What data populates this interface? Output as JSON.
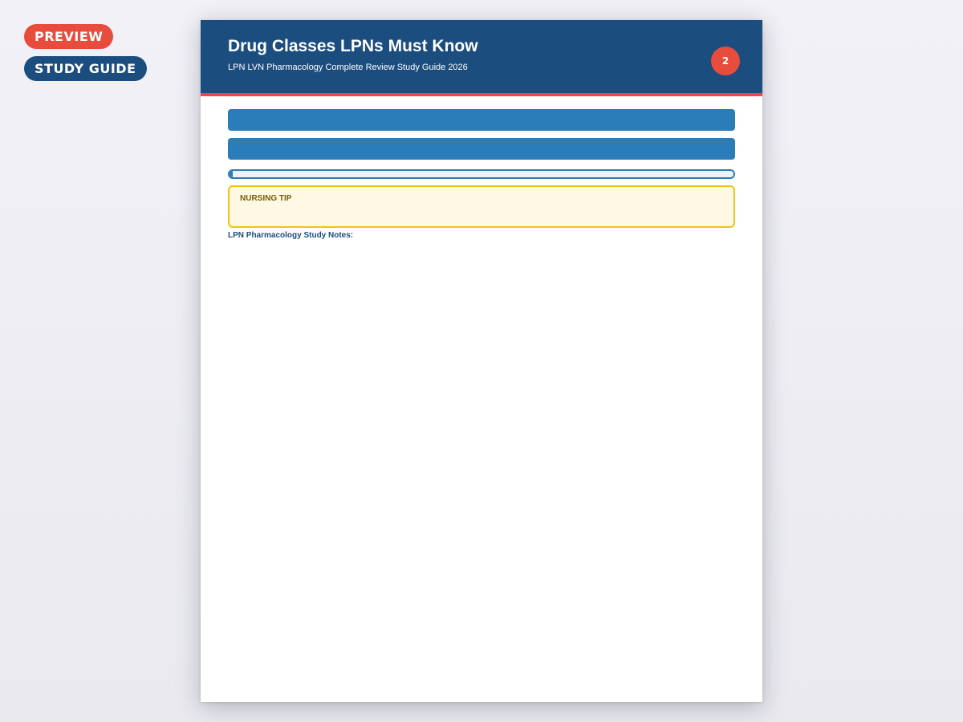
{
  "badges": {
    "preview": "PREVIEW",
    "study_guide": "STUDY GUIDE"
  },
  "page": {
    "title": "Drug Classes LPNs Must Know",
    "subtitle": "LPN LVN Pharmacology Complete Review Study Guide 2026",
    "page_number": "2"
  },
  "progress": {
    "fraction": 0.005
  },
  "nursing_tip": {
    "label": "NURSING TIP"
  },
  "notes": {
    "heading": "LPN Pharmacology Study Notes:"
  },
  "colors": {
    "preview_badge": "#e74c3c",
    "study_guide_badge": "#1b4d7e",
    "header_bg": "#1b4d7e",
    "header_accent": "#e74c3c",
    "page_number_bg": "#e74c3c",
    "section_bar": "#2a7db9",
    "progress_fill": "#2a7db9",
    "tip_border": "#f1c40f",
    "tip_bg": "#fef8e4"
  }
}
